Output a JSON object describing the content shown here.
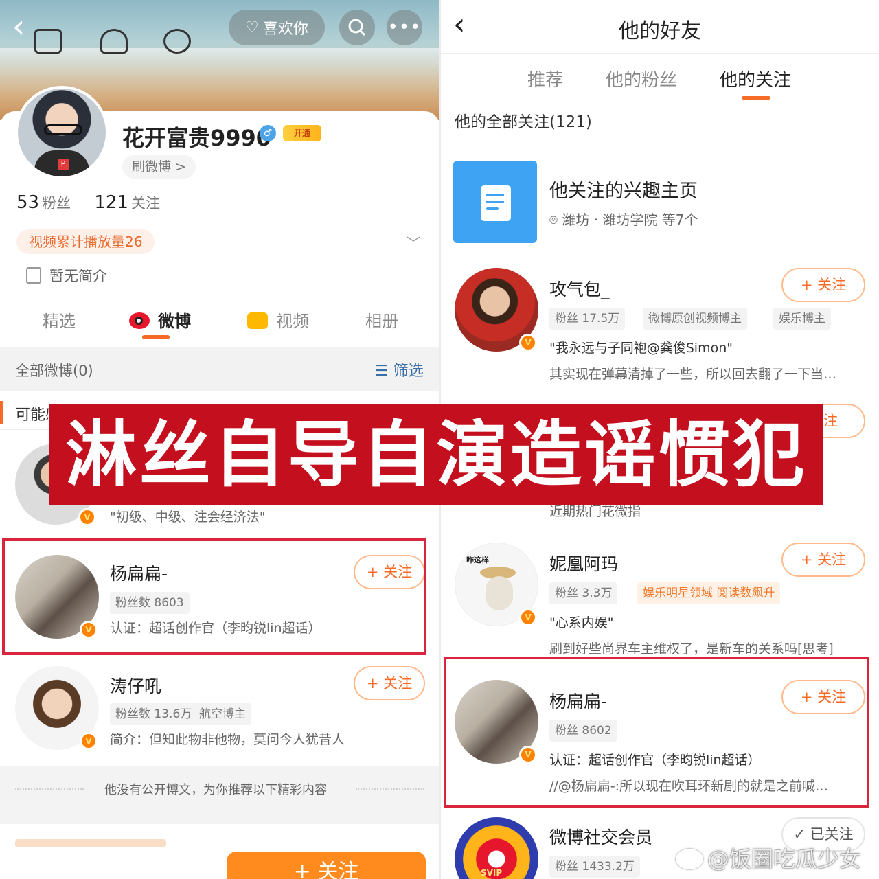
{
  "left": {
    "header": {
      "like_label": "喜欢你"
    },
    "profile": {
      "username": "花开富贵9990",
      "vip_label": "开通",
      "shua_label": "刷微博 >",
      "fans_count": "53",
      "fans_label": "粉丝",
      "follow_count": "121",
      "follow_label": "关注",
      "video_badge": "视频累计播放量26",
      "intro": "暂无简介"
    },
    "tabs": [
      "精选",
      "微博",
      "视频",
      "相册"
    ],
    "filter": {
      "all_label": "全部微博(0)",
      "filter_label": "筛选"
    },
    "maybe_label": "可能感",
    "people": [
      {
        "desc": "\"初级、中级、注会经济法\""
      },
      {
        "name": "杨扁扁-",
        "tags": [
          "粉丝数 8603"
        ],
        "desc": "认证：超话创作官（李昀锐lin超话）",
        "follow": "+ 关注"
      },
      {
        "name": "涛仔吼",
        "tags": [
          "粉丝数 13.6万",
          "航空博主"
        ],
        "desc": "简介：但知此物非他物，莫问今人犹昔人",
        "follow": "+ 关注"
      }
    ],
    "no_public": "他没有公开博文，为你推荐以下精彩内容",
    "bottom_follow": "+ 关注"
  },
  "right": {
    "title": "他的好友",
    "tabs": [
      "推荐",
      "他的粉丝",
      "他的关注"
    ],
    "all_follow": "他的全部关注(121)",
    "interest": {
      "title": "他关注的兴趣主页",
      "location": "潍坊 · 潍坊学院 等7个"
    },
    "people": [
      {
        "name": "攻气包_",
        "tags": [
          "粉丝 17.5万",
          "微博原创视频博主",
          "娱乐博主"
        ],
        "desc1": "\"我永远与子同袍@龚俊Simon\"",
        "desc2": "其实现在弹幕清掉了一些，所以回去翻了一下当…",
        "follow": "+ 关注"
      },
      {
        "partial_desc": "近期热门花微指",
        "follow": "关注"
      },
      {
        "name": "妮凰阿玛",
        "tags": [
          "粉丝 3.3万"
        ],
        "highlight_tag": "娱乐明星领域 阅读数飙升",
        "desc1": "\"心系内娱\"",
        "desc2": "刷到好些尚界车主维权了，是新车的关系吗[思考]",
        "follow": "+ 关注",
        "sticker_text": "咋这样"
      },
      {
        "name": "杨扁扁-",
        "tags": [
          "粉丝 8602"
        ],
        "desc1": "认证：超话创作官（李昀锐lin超话）",
        "desc2": "//@杨扁扁-:所以现在吹耳环新剧的就是之前喊…",
        "follow": "+ 关注"
      },
      {
        "name": "微博社交会员",
        "tags": [
          "粉丝 1433.2万"
        ],
        "follow": "✓ 已关注",
        "badge_text": "SVIP"
      }
    ]
  },
  "overlay_text": "淋丝自导自演造谣惯犯",
  "watermark": "@饭圈吃瓜少女",
  "colors": {
    "accent": "#f86b26",
    "overlay_red": "#c4101e",
    "highlight_red": "#d8243c",
    "verified": "#ff8200"
  }
}
